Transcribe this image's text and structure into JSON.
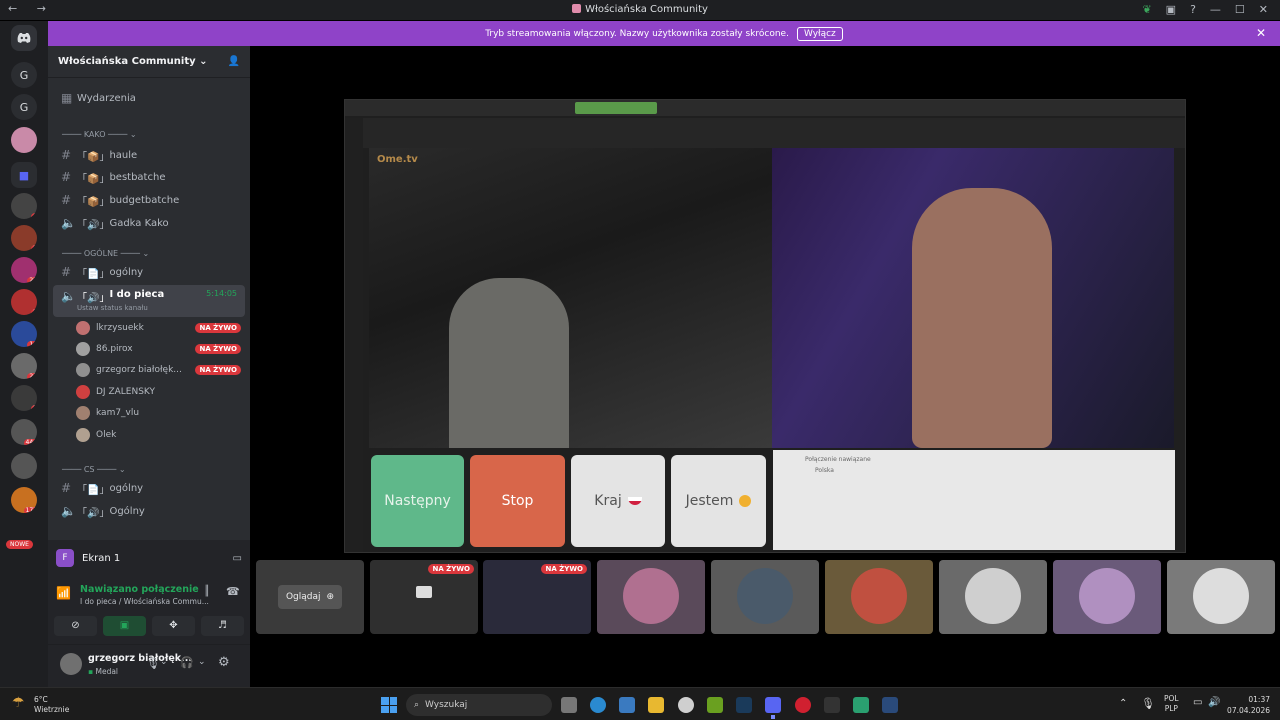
{
  "window": {
    "title": "Włościańska Community",
    "nav": "← →"
  },
  "banner": {
    "text": "Tryb streamowania włączony. Nazwy użytkownika zostały skrócone.",
    "button": "Wyłącz"
  },
  "servers": {
    "items": [
      {
        "label": "G"
      },
      {
        "label": "G"
      }
    ],
    "badges": [
      "6",
      "2",
      "25",
      "5",
      "16",
      "23",
      "2",
      "446",
      "177"
    ],
    "new_label": "NOWE"
  },
  "sidebar": {
    "server_name": "Włościańska Community",
    "events": "Wydarzenia",
    "categories": [
      {
        "name": "KAKO"
      },
      {
        "name": "OGÓLNE"
      },
      {
        "name": "CS"
      }
    ],
    "channels": [
      {
        "name": "haule",
        "type": "text"
      },
      {
        "name": "bestbatche",
        "type": "text"
      },
      {
        "name": "budgetbatche",
        "type": "text"
      },
      {
        "name": "Gadka Kako",
        "type": "voice"
      },
      {
        "name": "ogólny",
        "type": "text"
      },
      {
        "name": "I do pieca",
        "type": "voice",
        "status": "Ustaw status kanału",
        "timer": "5:14:05"
      },
      {
        "name": "ogólny",
        "type": "text"
      },
      {
        "name": "Ogólny",
        "type": "voice"
      }
    ],
    "voice_users": [
      {
        "name": "lkrzysuekk",
        "live": "NA ŻYWO",
        "color": "#c07070"
      },
      {
        "name": "86.pirox",
        "live": "NA ŻYWO",
        "color": "#a0a0a0"
      },
      {
        "name": "grzegorz białołęk...",
        "live": "NA ŻYWO",
        "color": "#909090"
      },
      {
        "name": "DJ ZALENSKY",
        "live": "",
        "color": "#d04040"
      },
      {
        "name": "kam7_vlu",
        "live": "",
        "color": "#a08070"
      },
      {
        "name": "Olek",
        "live": "",
        "color": "#b0a090"
      }
    ]
  },
  "panel": {
    "screen_label": "Ekran 1",
    "connection_status": "Nawiązano połączenie",
    "connection_detail": "I do pieca / Włościańska Commu...",
    "user_name": "grzegorz białołęk...",
    "user_status": "Medal",
    "status_color": "#23a55a"
  },
  "stream": {
    "omegle_logo": "Ome.tv",
    "buttons": [
      {
        "label": "Następny",
        "color": "#5fb88a"
      },
      {
        "label": "Stop",
        "color": "#d8664a"
      },
      {
        "label": "Kraj",
        "color": "#ececec"
      },
      {
        "label": "Jestem",
        "color": "#ececec"
      }
    ],
    "chat_line1": "Połączenie nawiązane",
    "chat_line2": "Polska"
  },
  "strip": {
    "watch_label": "Oglądaj",
    "live_label": "NA ŻYWO"
  },
  "taskbar": {
    "weather_temp": "6°C",
    "weather_desc": "Wietrznie",
    "search_placeholder": "Wyszukaj",
    "lang1": "POL",
    "lang2": "PLP",
    "time": "01:37",
    "date": "07.04.2026"
  }
}
